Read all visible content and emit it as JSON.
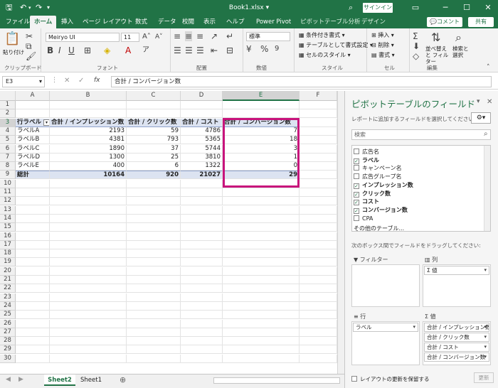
{
  "window": {
    "title": "Book1.xlsx",
    "signin": "サインイン"
  },
  "tabs": [
    "ファイル",
    "ホーム",
    "挿入",
    "ページ レイアウト",
    "数式",
    "データ",
    "校閲",
    "表示",
    "ヘルプ",
    "Power Pivot",
    "ピボットテーブル分析",
    "デザイン"
  ],
  "comment_label": "コメント",
  "share_label": "共有",
  "ribbon": {
    "paste": "貼り付け",
    "clipboard": "クリップボード",
    "font_name": "Meiryo UI",
    "font_size": "11",
    "font": "フォント",
    "align": "配置",
    "number_format": "標準",
    "number": "数値",
    "cond_format": "条件付き書式",
    "table_format": "テーブルとして書式設定",
    "cell_style": "セルのスタイル",
    "style": "スタイル",
    "insert": "挿入",
    "delete": "削除",
    "format": "書式",
    "cell": "セル",
    "sort_filter": "並べ替えと フィルター",
    "find_select": "検索と 選択",
    "edit": "編集"
  },
  "formula_bar": {
    "name_box": "E3",
    "formula": "合計 / コンバージョン数",
    "fx": "fx"
  },
  "columns": [
    "A",
    "B",
    "C",
    "D",
    "E",
    "F"
  ],
  "rows": [
    "1",
    "2",
    "3",
    "4",
    "5",
    "6",
    "7",
    "8",
    "9",
    "10",
    "11",
    "12",
    "13",
    "14",
    "15",
    "16",
    "17",
    "18",
    "19",
    "20",
    "21",
    "22",
    "23",
    "24",
    "25",
    "26",
    "27",
    "28",
    "29",
    "30"
  ],
  "pivot": {
    "headers": [
      "行ラベル",
      "合計 / インプレッション数",
      "合計 / クリック数",
      "合計 / コスト",
      "合計 / コンバージョン数"
    ],
    "rows": [
      [
        "ラベルA",
        "2193",
        "59",
        "4786",
        "7"
      ],
      [
        "ラベルB",
        "4381",
        "793",
        "5365",
        "18"
      ],
      [
        "ラベルC",
        "1890",
        "37",
        "5744",
        "3"
      ],
      [
        "ラベルD",
        "1300",
        "25",
        "3810",
        "1"
      ],
      [
        "ラベルE",
        "400",
        "6",
        "1322",
        "0"
      ]
    ],
    "total": [
      "総計",
      "10164",
      "920",
      "21027",
      "29"
    ]
  },
  "sheets": [
    "Sheet2",
    "Sheet1"
  ],
  "field_pane": {
    "title": "ピボットテーブルのフィールド",
    "subtitle": "レポートに追加するフィールドを選択してください:",
    "search_placeholder": "検索",
    "fields": [
      {
        "name": "広告名",
        "checked": false
      },
      {
        "name": "ラベル",
        "checked": true
      },
      {
        "name": "キャンペーン名",
        "checked": false
      },
      {
        "name": "広告グループ名",
        "checked": false
      },
      {
        "name": "インプレッション数",
        "checked": true
      },
      {
        "name": "クリック数",
        "checked": true
      },
      {
        "name": "コスト",
        "checked": true
      },
      {
        "name": "コンバージョン数",
        "checked": true
      },
      {
        "name": "CPA",
        "checked": false
      }
    ],
    "other_tables": "その他のテーブル...",
    "drag_hint": "次のボックス間でフィールドをドラッグしてください:",
    "filter_label": "フィルター",
    "column_label": "列",
    "column_items": [
      "Σ 値"
    ],
    "row_label": "行",
    "row_items": [
      "ラベル"
    ],
    "values_label": "Σ 値",
    "values_items": [
      "合計 / インプレッション数",
      "合計 / クリック数",
      "合計 / コスト",
      "合計 / コンバージョン数"
    ],
    "defer": "レイアウトの更新を保留する",
    "update": "更新"
  },
  "colors": {
    "excel_green": "#217346",
    "highlight": "#c8137c"
  }
}
